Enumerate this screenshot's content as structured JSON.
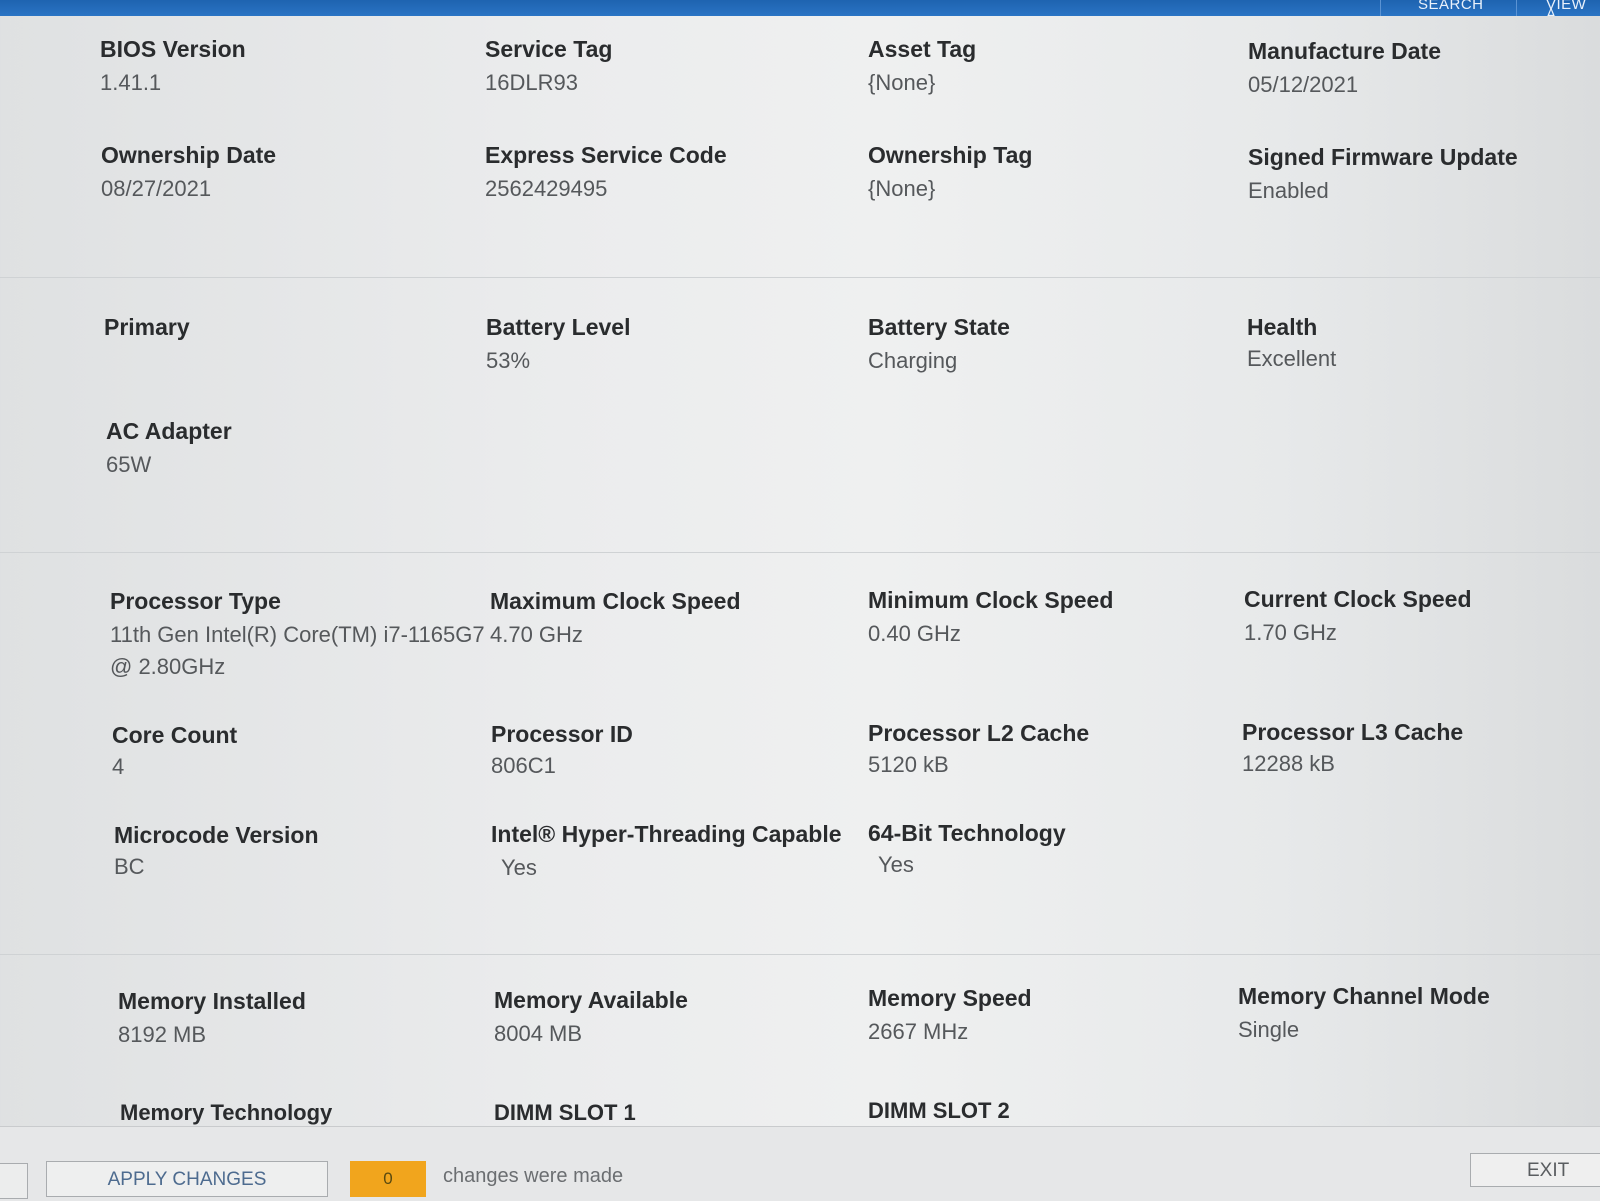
{
  "top_bar": {
    "search_label": "SEARCH",
    "view_label": "VIEW A",
    "accent_color": "#2268b8"
  },
  "system": {
    "bios_version": {
      "label": "BIOS Version",
      "value": "1.41.1"
    },
    "service_tag": {
      "label": "Service Tag",
      "value": "16DLR93"
    },
    "asset_tag": {
      "label": "Asset Tag",
      "value": "{None}"
    },
    "manufacture_date": {
      "label": "Manufacture Date",
      "value": "05/12/2021"
    },
    "ownership_date": {
      "label": "Ownership Date",
      "value": "08/27/2021"
    },
    "express_service_code": {
      "label": "Express Service Code",
      "value": "2562429495"
    },
    "ownership_tag": {
      "label": "Ownership Tag",
      "value": "{None}"
    },
    "signed_firmware_update": {
      "label": "Signed Firmware Update",
      "value": "Enabled"
    }
  },
  "battery": {
    "primary": {
      "label": "Primary"
    },
    "battery_level": {
      "label": "Battery Level",
      "value": "53%"
    },
    "battery_state": {
      "label": "Battery State",
      "value": "Charging"
    },
    "health": {
      "label": "Health",
      "value": "Excellent"
    },
    "ac_adapter": {
      "label": "AC Adapter",
      "value": "65W"
    }
  },
  "processor": {
    "processor_type": {
      "label": "Processor Type",
      "value_line1": "11th Gen Intel(R) Core(TM) i7-1165G7",
      "value_line2": "@ 2.80GHz"
    },
    "max_clock": {
      "label": "Maximum Clock Speed",
      "value": "4.70 GHz"
    },
    "min_clock": {
      "label": "Minimum Clock Speed",
      "value": "0.40 GHz"
    },
    "current_clock": {
      "label": "Current Clock Speed",
      "value": "1.70 GHz"
    },
    "core_count": {
      "label": "Core Count",
      "value": "4"
    },
    "processor_id": {
      "label": "Processor ID",
      "value": "806C1"
    },
    "l2_cache": {
      "label": "Processor L2 Cache",
      "value": "5120 kB"
    },
    "l3_cache": {
      "label": "Processor L3 Cache",
      "value": "12288 kB"
    },
    "microcode": {
      "label": "Microcode Version",
      "value": "BC"
    },
    "hyperthreading": {
      "label": "Intel® Hyper-Threading Capable",
      "value": "Yes"
    },
    "bit64": {
      "label": "64-Bit Technology",
      "value": "Yes"
    }
  },
  "memory": {
    "installed": {
      "label": "Memory Installed",
      "value": "8192 MB"
    },
    "available": {
      "label": "Memory Available",
      "value": "8004 MB"
    },
    "speed": {
      "label": "Memory Speed",
      "value": "2667 MHz"
    },
    "channel_mode": {
      "label": "Memory Channel Mode",
      "value": "Single"
    },
    "technology": {
      "label": "Memory Technology"
    },
    "dimm1": {
      "label": "DIMM SLOT 1"
    },
    "dimm2": {
      "label": "DIMM SLOT 2"
    }
  },
  "footer": {
    "apply_label": "APPLY CHANGES",
    "changes_count": "0",
    "changes_text": "changes were made",
    "exit_label": "EXIT",
    "badge_color": "#f1a51d"
  }
}
